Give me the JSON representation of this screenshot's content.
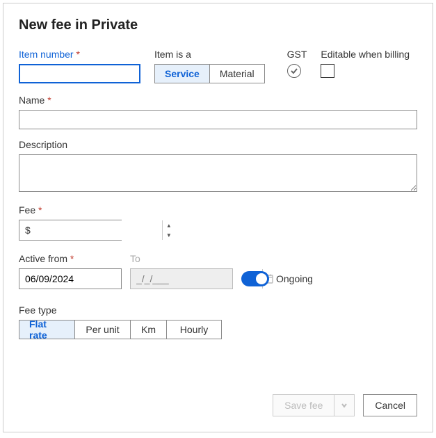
{
  "title": "New fee in Private",
  "item_number": {
    "label": "Item number",
    "value": ""
  },
  "item_is_a": {
    "label": "Item is a",
    "options": [
      "Service",
      "Material"
    ],
    "selected": 0
  },
  "gst": {
    "label": "GST",
    "checked": true
  },
  "editable_when_billing": {
    "label": "Editable when billing",
    "checked": false
  },
  "name": {
    "label": "Name",
    "value": ""
  },
  "description": {
    "label": "Description",
    "value": ""
  },
  "fee": {
    "label": "Fee",
    "currency": "$",
    "value": ""
  },
  "active_from": {
    "label": "Active from",
    "value": "06/09/2024"
  },
  "to": {
    "label": "To",
    "placeholder": "_/_/___"
  },
  "ongoing": {
    "label": "Ongoing",
    "on": true
  },
  "fee_type": {
    "label": "Fee type",
    "options": [
      "Flat rate",
      "Per unit",
      "Km",
      "Hourly"
    ],
    "selected": 0
  },
  "buttons": {
    "save": "Save fee",
    "cancel": "Cancel"
  }
}
